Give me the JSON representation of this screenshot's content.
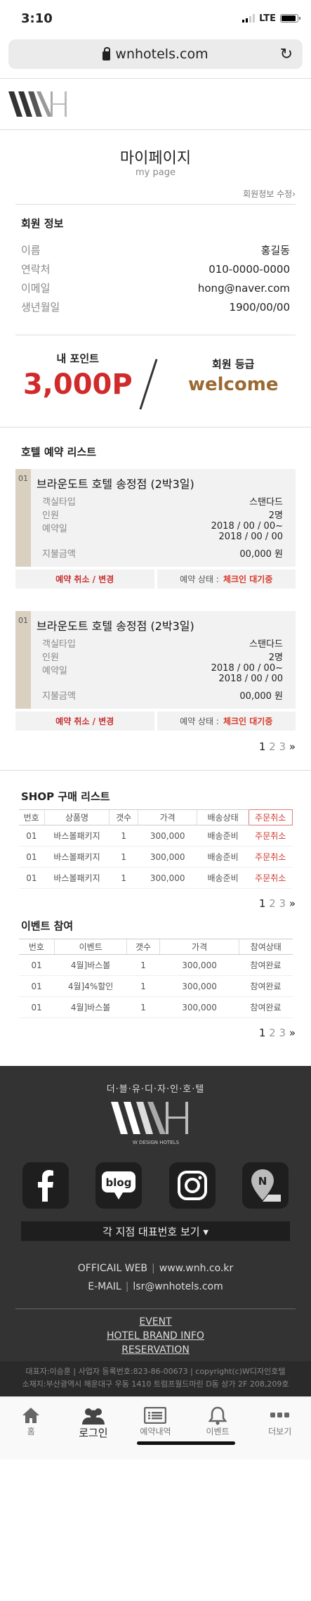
{
  "status": {
    "time": "3:10",
    "network": "LTE"
  },
  "browser": {
    "url": "wnhotels.com"
  },
  "page": {
    "title": "마이페이지",
    "subtitle": "my page",
    "edit_link": "회원정보 수정›"
  },
  "member": {
    "section_title": "회원 정보",
    "rows": [
      {
        "label": "이름",
        "value": "홍길동"
      },
      {
        "label": "연락처",
        "value": "010-0000-0000"
      },
      {
        "label": "이메일",
        "value": "hong@naver.com"
      },
      {
        "label": "생년월일",
        "value": "1900/00/00"
      }
    ]
  },
  "points": {
    "label": "내 포인트",
    "value": "3,000P",
    "grade_label": "회원 등급",
    "grade_value": "welcome"
  },
  "reservations": {
    "section_title": "호텔 예약 리스트",
    "items": [
      {
        "num": "01",
        "title": "브라운도트 호텔 송정점 (2박3일)",
        "room_label": "객실타입",
        "room": "스탠다드",
        "guest_label": "인원",
        "guest": "2명",
        "date_label": "예약일",
        "date1": "2018 / 00 / 00~",
        "date2": "2018 / 00 / 00",
        "pay_label": "지불금액",
        "pay": "00,000 원",
        "cancel": "예약 취소 / 변경",
        "state_label": "예약 상태 :",
        "state": "체크인 대기중"
      },
      {
        "num": "01",
        "title": "브라운도트 호텔 송정점 (2박3일)",
        "room_label": "객실타입",
        "room": "스탠다드",
        "guest_label": "인원",
        "guest": "2명",
        "date_label": "예약일",
        "date1": "2018 / 00 / 00~",
        "date2": "2018 / 00 / 00",
        "pay_label": "지불금액",
        "pay": "00,000 원",
        "cancel": "예약 취소 / 변경",
        "state_label": "예약 상태 :",
        "state": "체크인 대기중"
      }
    ],
    "pager": {
      "p1": "1",
      "p2": "2",
      "p3": "3",
      "next": "»"
    }
  },
  "shop": {
    "section_title": "SHOP 구매 리스트",
    "headers": [
      "번호",
      "상품명",
      "갯수",
      "가격",
      "배송상태",
      "주문취소"
    ],
    "rows": [
      [
        "01",
        "바스볼패키지",
        "1",
        "300,000",
        "배송준비",
        "주문취소"
      ],
      [
        "01",
        "바스볼패키지",
        "1",
        "300,000",
        "배송준비",
        "주문취소"
      ],
      [
        "01",
        "바스볼패키지",
        "1",
        "300,000",
        "배송준비",
        "주문취소"
      ]
    ],
    "pager": {
      "p1": "1",
      "p2": "2",
      "p3": "3",
      "next": "»"
    }
  },
  "event": {
    "section_title": "이벤트 참여",
    "headers": [
      "번호",
      "이벤트",
      "갯수",
      "가격",
      "참여상태"
    ],
    "rows": [
      [
        "01",
        "4월]바스볼",
        "1",
        "300,000",
        "참여완료"
      ],
      [
        "01",
        "4월]4%할인",
        "1",
        "300,000",
        "참여완료"
      ],
      [
        "01",
        "4월]바스볼",
        "1",
        "300,000",
        "참여완료"
      ]
    ],
    "pager": {
      "p1": "1",
      "p2": "2",
      "p3": "3",
      "next": "»"
    }
  },
  "footer": {
    "tagline": "더·블·유·디·자·인·호·텔",
    "logo_sub": "W DESIGN HOTELS",
    "branch_button": "각 지점 대표번호 보기 ▾",
    "web_label": "OFFICAIL WEB",
    "web_value": "www.wnh.co.kr",
    "mail_label": "E-MAIL",
    "mail_value": "lsr@wnhotels.com",
    "links": [
      "EVENT",
      "HOTEL BRAND INFO",
      "RESERVATION"
    ],
    "copy1": "대표자:이승훈 | 사업자 등록번호:823-86-00673 | copyright(c)W디자인호텔",
    "copy2": "소재지:부산광역시 해운대구 우동 1410 트럼프월드마린 D동 상가 2F 208,209호"
  },
  "tabs": [
    {
      "label": "홈",
      "icon": "home-icon"
    },
    {
      "label": "로그인",
      "icon": "people-icon"
    },
    {
      "label": "예약내역",
      "icon": "list-icon"
    },
    {
      "label": "이벤트",
      "icon": "bell-icon"
    },
    {
      "label": "더보기",
      "icon": "more-icon"
    }
  ],
  "colors": {
    "accent_red": "#d02a2a",
    "grade_brown": "#9a6a32",
    "footer_bg": "#333333"
  }
}
